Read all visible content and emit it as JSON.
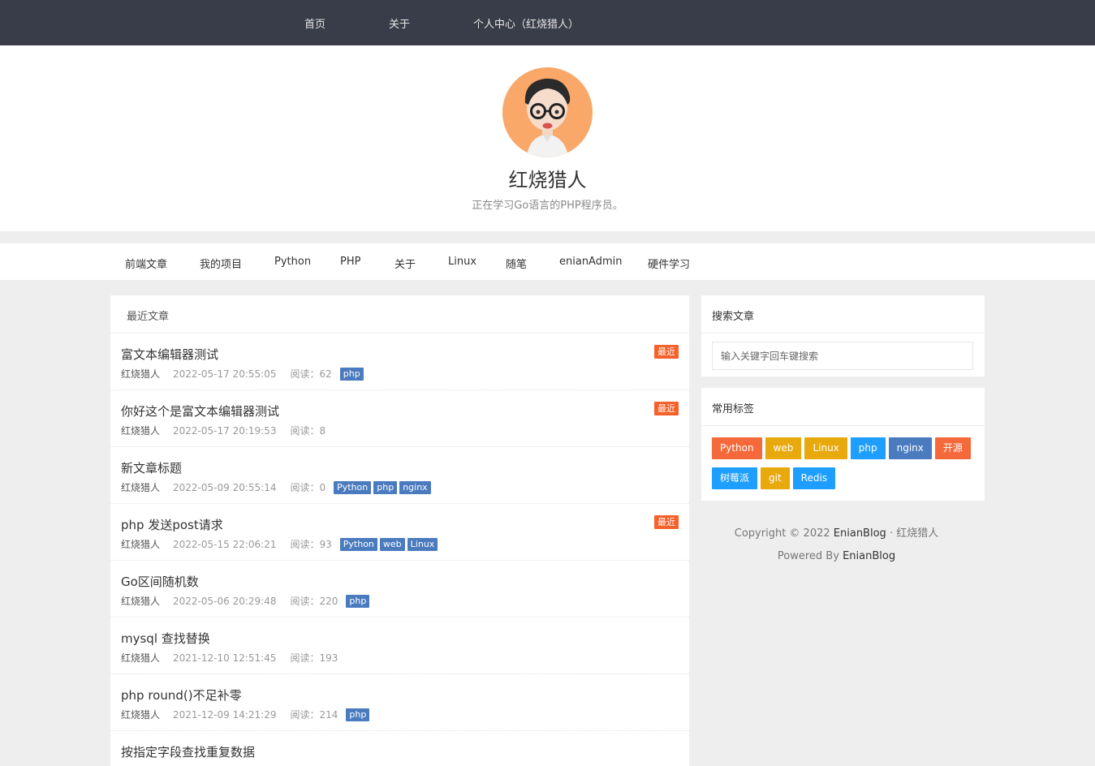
{
  "topnav": {
    "items": [
      {
        "label": "首页"
      },
      {
        "label": "关于"
      },
      {
        "label": "个人中心（红烧猎人）"
      }
    ]
  },
  "profile": {
    "name": "红烧猎人",
    "description": "正在学习Go语言的PHP程序员。"
  },
  "categories": [
    {
      "label": "前端文章"
    },
    {
      "label": "我的项目"
    },
    {
      "label": "Python"
    },
    {
      "label": "PHP"
    },
    {
      "label": "关于"
    },
    {
      "label": "Linux"
    },
    {
      "label": "随笔"
    },
    {
      "label": "enianAdmin"
    },
    {
      "label": "硬件学习"
    }
  ],
  "recent": {
    "heading": "最近文章",
    "badge_label": "最近",
    "reads_prefix": "阅读：",
    "posts": [
      {
        "title": "富文本编辑器测试",
        "author": "红烧猎人",
        "date": "2022-05-17 20:55:05",
        "reads": "62",
        "tags": [
          "php"
        ],
        "recent": true
      },
      {
        "title": "你好这个是富文本编辑器测试",
        "author": "红烧猎人",
        "date": "2022-05-17 20:19:53",
        "reads": "8",
        "tags": [],
        "recent": true
      },
      {
        "title": "新文章标题",
        "author": "红烧猎人",
        "date": "2022-05-09 20:55:14",
        "reads": "0",
        "tags": [
          "Python",
          "php",
          "nginx"
        ],
        "recent": false
      },
      {
        "title": "php 发送post请求",
        "author": "红烧猎人",
        "date": "2022-05-15 22:06:21",
        "reads": "93",
        "tags": [
          "Python",
          "web",
          "Linux"
        ],
        "recent": true
      },
      {
        "title": "Go区间随机数",
        "author": "红烧猎人",
        "date": "2022-05-06 20:29:48",
        "reads": "220",
        "tags": [
          "php"
        ],
        "recent": false
      },
      {
        "title": "mysql 查找替换",
        "author": "红烧猎人",
        "date": "2021-12-10 12:51:45",
        "reads": "193",
        "tags": [],
        "recent": false
      },
      {
        "title": "php round()不足补零",
        "author": "红烧猎人",
        "date": "2021-12-09 14:21:29",
        "reads": "214",
        "tags": [
          "php"
        ],
        "recent": false
      },
      {
        "title": "按指定字段查找重复数据",
        "author": "",
        "date": "",
        "reads": "",
        "tags": [],
        "recent": false
      }
    ]
  },
  "search": {
    "heading": "搜索文章",
    "placeholder": "输入关键字回车键搜索"
  },
  "tags_panel": {
    "heading": "常用标签",
    "tags": [
      {
        "label": "Python",
        "color": "#f5693b"
      },
      {
        "label": "web",
        "color": "#e8a90c"
      },
      {
        "label": "Linux",
        "color": "#e8a90c"
      },
      {
        "label": "php",
        "color": "#1e9fff"
      },
      {
        "label": "nginx",
        "color": "#4b7bbf"
      },
      {
        "label": "开源",
        "color": "#f5693b"
      },
      {
        "label": "树莓派",
        "color": "#1e9fff"
      },
      {
        "label": "git",
        "color": "#e8a90c"
      },
      {
        "label": "Redis",
        "color": "#1e9fff"
      }
    ]
  },
  "footer": {
    "copyright": "Copyright © 2022",
    "site": "EnianBlog",
    "separator": "·",
    "owner": "红烧猎人",
    "powered": "Powered By",
    "powered_link": "EnianBlog"
  },
  "colors": {
    "topnav_bg": "#393d49",
    "tag_blue": "#4b7bbf",
    "recent_badge": "#f5612a"
  }
}
